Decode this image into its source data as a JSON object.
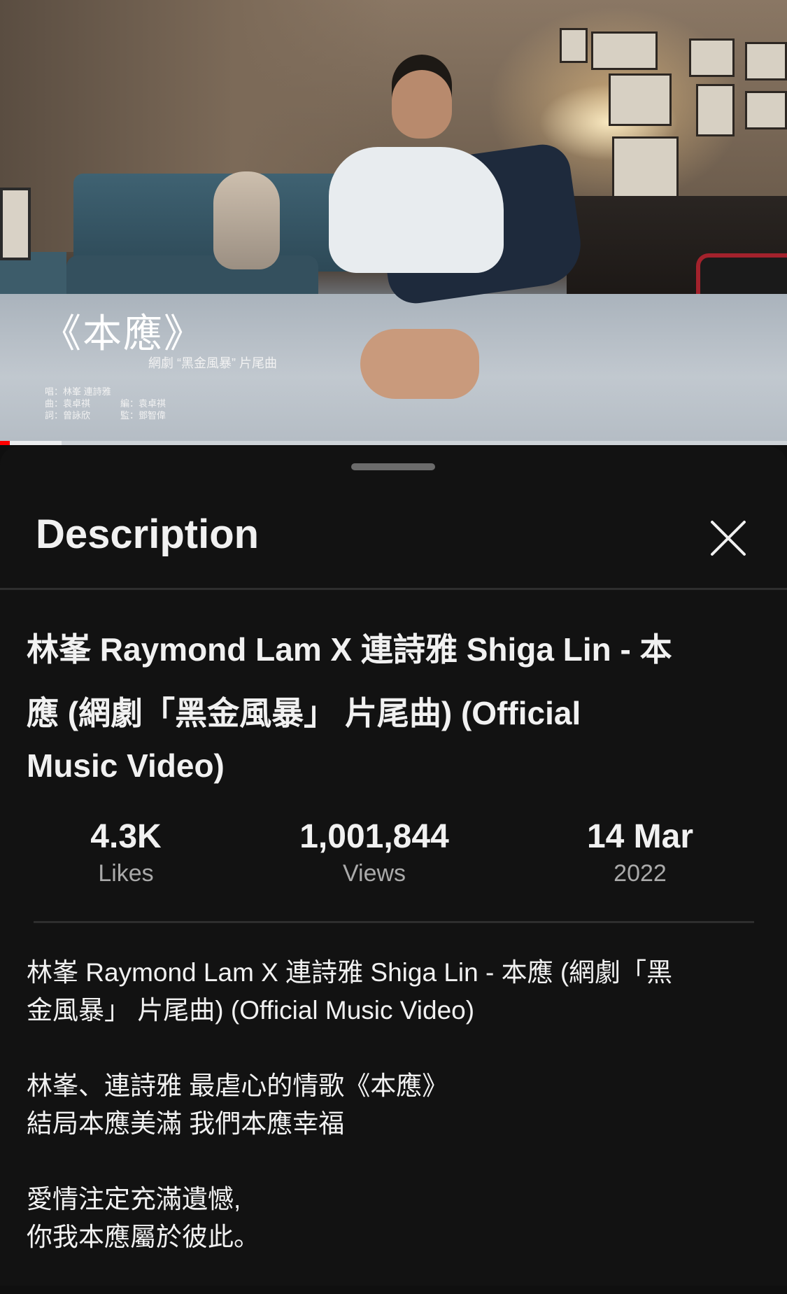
{
  "video": {
    "overlay_title": "《本應》",
    "overlay_subtitle": "網劇 “黑金風暴” 片尾曲",
    "credits": {
      "row1_left": "唱：林峯 連詩雅",
      "row2_left": "曲：袁卓祺",
      "row2_right": "編：袁卓祺",
      "row3_left": "詞：曾詠欣",
      "row3_right": "監：鄧智偉"
    },
    "progress_played_fraction": 0.012,
    "progress_buffered_fraction": 0.078,
    "progress_color": "#ff0000"
  },
  "sheet": {
    "title": "Description",
    "close_icon": "close-icon"
  },
  "details": {
    "title_line1": "林峯 Raymond Lam X 連詩雅 Shiga Lin - 本",
    "title_line2": "應 (網劇「黑金風暴」 片尾曲) (Official",
    "title_line3": "Music Video)",
    "stats": {
      "likes_value": "4.3K",
      "likes_label": "Likes",
      "views_value": "1,001,844",
      "views_label": "Views",
      "date_value": "14 Mar",
      "date_label": "2022"
    },
    "description": {
      "p1_line1": "林峯 Raymond Lam X 連詩雅 Shiga Lin - 本應 (網劇「黑",
      "p1_line2": "金風暴」 片尾曲) (Official Music Video)",
      "p2_line1": "林峯、連詩雅 最虐心的情歌《本應》",
      "p2_line2": "結局本應美滿 我們本應幸福",
      "p3_line1": "愛情注定充滿遺憾,",
      "p3_line2": "你我本應屬於彼此。"
    }
  }
}
